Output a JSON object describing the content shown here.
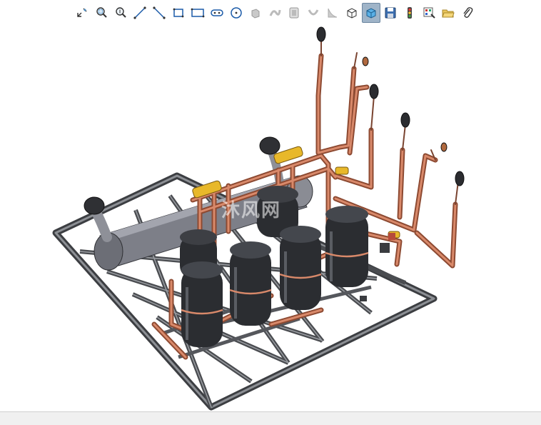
{
  "toolbar": {
    "tools": [
      {
        "icon": "zoom-to-fit-icon"
      },
      {
        "icon": "zoom-area-icon"
      },
      {
        "icon": "zoom-in-out-icon"
      },
      {
        "icon": "sketch-line-icon"
      },
      {
        "icon": "centerline-icon"
      },
      {
        "icon": "rectangle-icon"
      },
      {
        "icon": "parallelogram-icon"
      },
      {
        "icon": "slot-icon"
      },
      {
        "icon": "circle-icon"
      },
      {
        "icon": "extrude-icon"
      },
      {
        "icon": "revolve-icon"
      },
      {
        "icon": "cut-icon"
      },
      {
        "icon": "hole-icon"
      },
      {
        "icon": "fillet-icon"
      },
      {
        "icon": "view-orientation-icon"
      },
      {
        "icon": "shaded-view-icon"
      },
      {
        "icon": "save-icon"
      },
      {
        "icon": "rebuild-traffic-light-icon"
      },
      {
        "icon": "options-icon"
      },
      {
        "icon": "open-folder-icon"
      },
      {
        "icon": "paperclip-icon"
      }
    ],
    "active_tool": "shaded-view-icon"
  },
  "model": {
    "watermark": "沐风网",
    "colors": {
      "frame": "#4a4c50",
      "pipe": "#c8765a",
      "compressor": "#2b2d31",
      "vessel": "#7a7c85",
      "valve": "#e8b82a"
    }
  }
}
